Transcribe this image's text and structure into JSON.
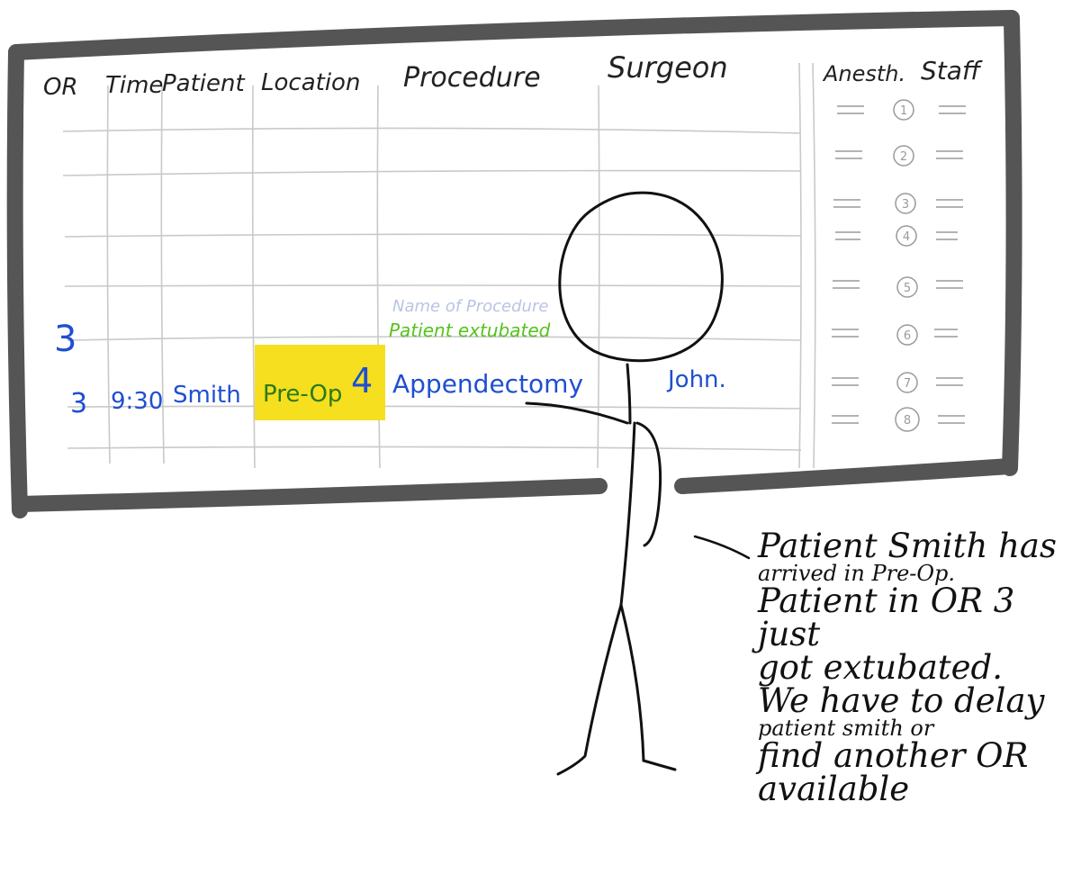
{
  "board": {
    "headers": [
      "OR",
      "Time",
      "Patient",
      "Location",
      "Procedure",
      "Surgeon",
      "Anesth.",
      "Staff"
    ],
    "staff_slots": [
      "1",
      "2",
      "3",
      "4",
      "5",
      "6",
      "7",
      "8"
    ],
    "or_row": {
      "or": "3",
      "procedure_placeholder": "Name of Procedure",
      "status": "Patient extubated"
    },
    "patient_row": {
      "or": "3",
      "time": "9:30",
      "patient": "Smith",
      "location": "Pre-Op",
      "room": "4",
      "procedure": "Appendectomy",
      "surgeon": "John."
    }
  },
  "speech_note": {
    "lines": [
      "Patient Smith has",
      "arrived in Pre-Op.",
      "Patient in OR 3 just",
      "got extubated.",
      "We have to delay",
      "patient smith or",
      "find another OR",
      "available"
    ]
  },
  "colors": {
    "frame": "#555555",
    "board_ink": "#1f4fd1",
    "status_ink": "#56c21c",
    "highlight": "#f5df1e"
  }
}
